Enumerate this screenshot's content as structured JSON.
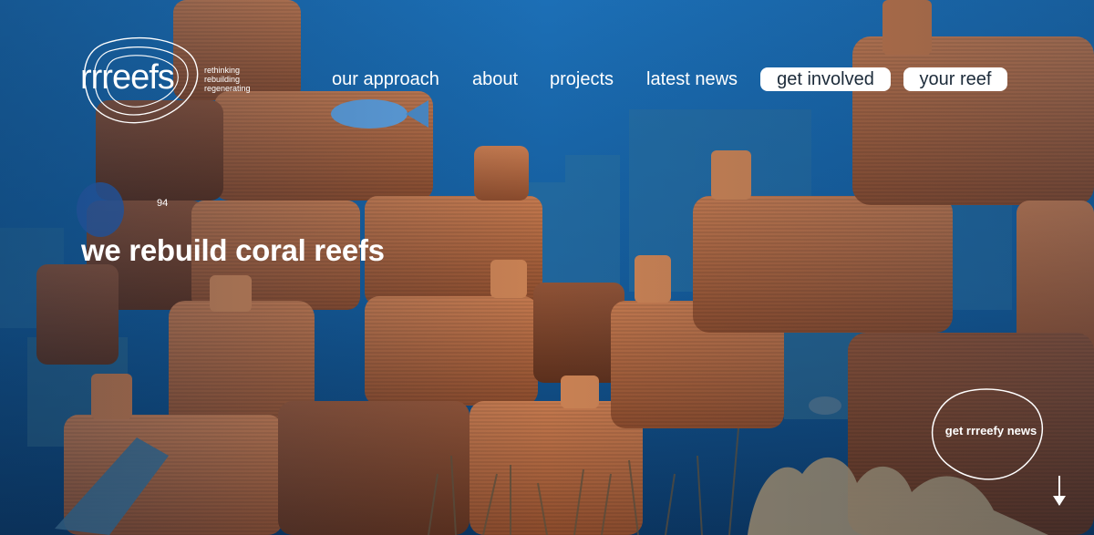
{
  "brand": {
    "wordmark": "rrreefs",
    "tagline": [
      "rethinking",
      "rebuilding",
      "regenerating"
    ]
  },
  "nav": {
    "links": [
      {
        "label": "our approach"
      },
      {
        "label": "about"
      },
      {
        "label": "projects"
      },
      {
        "label": "latest news"
      }
    ],
    "pills": [
      {
        "label": "get involved"
      },
      {
        "label": "your reef"
      }
    ]
  },
  "hero": {
    "headline": "we rebuild coral reefs",
    "fish_tag": "94"
  },
  "newsletter": {
    "label": "get rrreefy news"
  },
  "icons": {
    "logo": "rrreefs-contour-logo-icon",
    "newsletter_outline": "blob-outline-icon",
    "scroll": "arrow-down-icon"
  },
  "colors": {
    "water_deep": "#0e3f78",
    "water_light": "#1f73b8",
    "terracotta": "#b86d45",
    "terracotta_dark": "#7a4026",
    "pill_bg": "#ffffff",
    "pill_text": "#1c2b3a",
    "text": "#ffffff"
  }
}
